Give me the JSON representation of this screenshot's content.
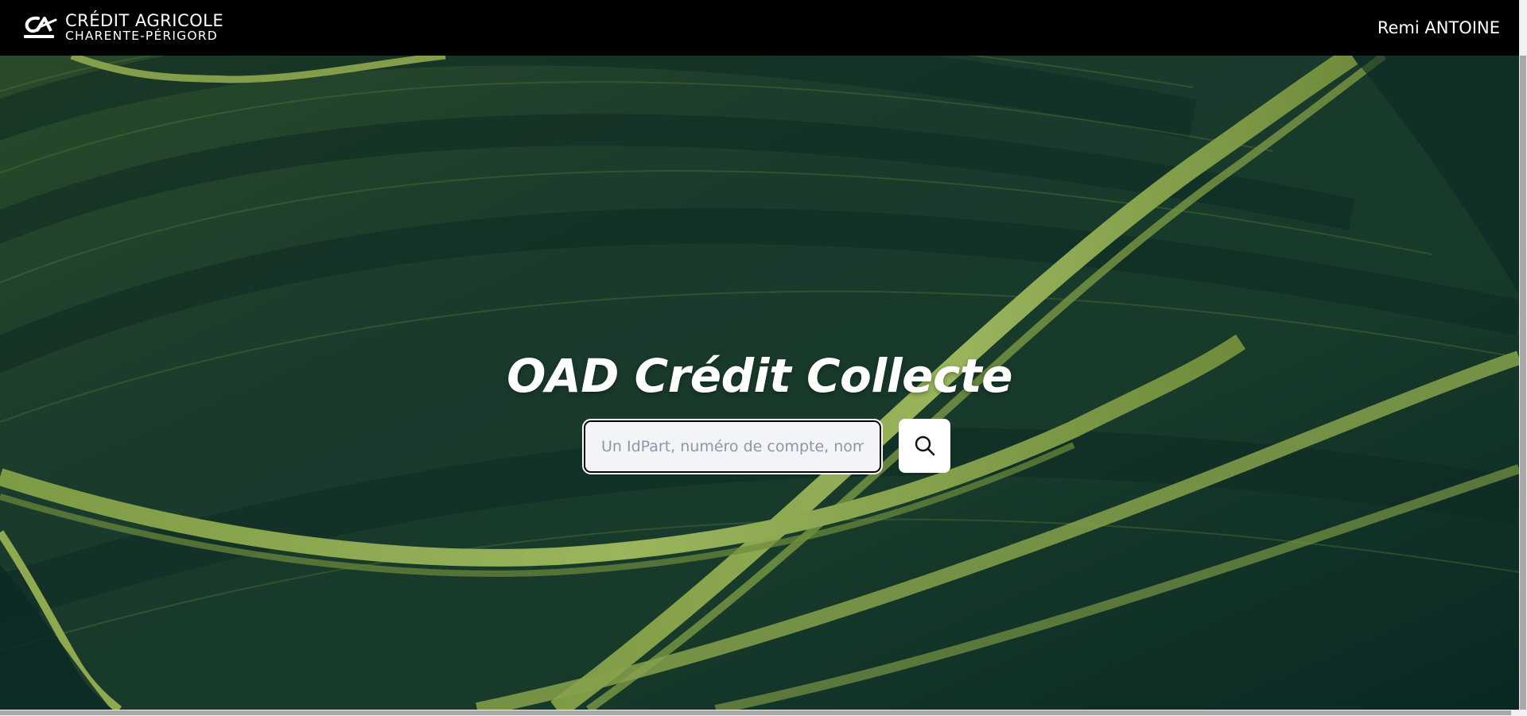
{
  "header": {
    "brand_line1": "CRÉDIT AGRICOLE",
    "brand_line2": "CHARENTE-PÉRIGORD",
    "logo_icon": "credit-agricole-logo",
    "user_name": "Remi ANTOINE"
  },
  "hero": {
    "title": "OAD Crédit Collecte",
    "search_placeholder": "Un IdPart, numéro de compte, nom/prénom...",
    "search_value": "",
    "search_icon": "search-icon"
  },
  "colors": {
    "header_bg": "#000000",
    "hero_bg": "#0d2b24",
    "accent_green": "#8fa94f",
    "text_white": "#ffffff"
  }
}
